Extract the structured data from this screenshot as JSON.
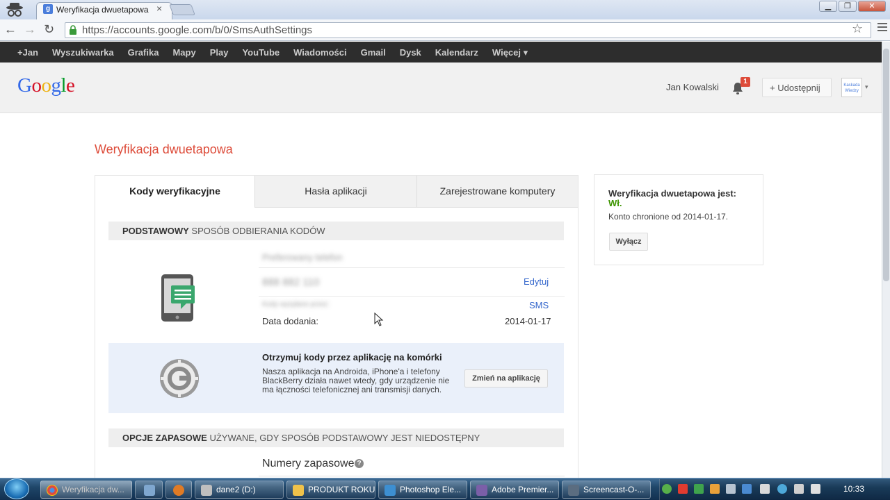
{
  "browser": {
    "tab_title": "Weryfikacja dwuetapowa",
    "tab_favicon": "g",
    "tab_close": "×",
    "url": "https://accounts.google.com/b/0/SmsAuthSettings",
    "window_controls": [
      "▁",
      "❐",
      "✕"
    ],
    "nav_icons": [
      "back-icon",
      "forward-icon",
      "reload-icon",
      "lock-icon",
      "star-icon",
      "menu-icon"
    ]
  },
  "gbar": {
    "items": [
      "+Jan",
      "Wyszukiwarka",
      "Grafika",
      "Mapy",
      "Play",
      "YouTube",
      "Wiadomości",
      "Gmail",
      "Dysk",
      "Kalendarz",
      "Więcej ▾"
    ]
  },
  "header": {
    "logo_letters": [
      "G",
      "o",
      "o",
      "g",
      "l",
      "e"
    ],
    "logo_colors": [
      "#3369e8",
      "#d50f25",
      "#eeb211",
      "#3369e8",
      "#009925",
      "#d50f25"
    ],
    "user_name": "Jan Kowalski",
    "notification_count": "1",
    "share_label": "+ Udostępnij",
    "avatar_text": "Kaskada Wiedzy",
    "avatar_caret": "▾"
  },
  "page": {
    "title": "Weryfikacja dwuetapowa",
    "tabs": [
      "Kody weryfikacyjne",
      "Hasła aplikacji",
      "Zarejestrowane komputery"
    ],
    "primary_section": {
      "bold": "PODSTAWOWY",
      "rest": " SPOSÓB ODBIERANIA KODÓW"
    },
    "phone_details": {
      "edit_label": "Edytuj",
      "method_label": "SMS",
      "date_label": "Data dodania:",
      "date_value": "2014-01-17"
    },
    "app_promo": {
      "title": "Otrzymuj kody przez aplikację na komórki",
      "description": "Nasza aplikacja na Androida, iPhone'a i telefony BlackBerry działa nawet wtedy, gdy urządzenie nie ma łączności telefonicznej ani transmisji danych.",
      "button": "Zmień na aplikację"
    },
    "backup_section": {
      "bold": "OPCJE ZAPASOWE",
      "rest": " UŻYWANE, GDY SPOSÓB PODSTAWOWY JEST NIEDOSTĘPNY"
    },
    "backup_numbers_label": "Numery zapasowe",
    "help_glyph": "?"
  },
  "status_card": {
    "title": "Weryfikacja dwuetapowa jest:",
    "state": "Wł.",
    "since": "Konto chronione od 2014-01-17.",
    "disable_button": "Wyłącz"
  },
  "taskbar": {
    "items": [
      {
        "label": "Weryfikacja dw...",
        "icon_color": "#e04a3f",
        "active": true
      },
      {
        "label": "",
        "icon_color": "#7fa7cf",
        "active": false
      },
      {
        "label": "",
        "icon_color": "#e07b25",
        "active": false
      },
      {
        "label": "dane2 (D:)",
        "icon_color": "#bfbfbf",
        "active": false
      },
      {
        "label": "PRODUKT ROKU",
        "icon_color": "#f0c24a",
        "active": false
      },
      {
        "label": "Photoshop Ele...",
        "icon_color": "#3d8fd1",
        "active": false
      },
      {
        "label": "Adobe Premier...",
        "icon_color": "#7b5fa8",
        "active": false
      },
      {
        "label": "Screencast-O-...",
        "icon_color": "#5b6d80",
        "active": false
      }
    ],
    "clock": "10:33",
    "tray_colors": [
      "#57b04a",
      "#e03b30",
      "#3fa34d",
      "#e9a13a",
      "#b7c4d1",
      "#4a8ad1",
      "#d9d9d9",
      "#4da8d8",
      "#cfcfcf",
      "#e0e0e0"
    ]
  }
}
